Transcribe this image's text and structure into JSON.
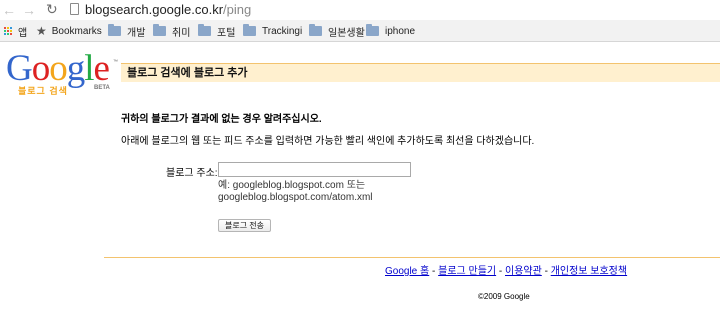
{
  "browser": {
    "url_host": "blogsearch.google.co.kr",
    "url_path": "/ping"
  },
  "bookmarks_bar": {
    "apps_label": "앱",
    "bookmarks_label": "Bookmarks",
    "folders": [
      "개발",
      "취미",
      "포털",
      "Trackingi",
      "일본생활",
      "iphone"
    ]
  },
  "logo": {
    "wordmark": "Google",
    "trademark": "™",
    "subtitle": "블로그 검색",
    "badge": "BETA",
    "colors": {
      "blue": "#3366cc",
      "red": "#dd2222",
      "yellow": "#f3a51c",
      "green": "#22aa44"
    }
  },
  "header": {
    "title": "블로그 검색에 블로그 추가",
    "accent_bg": "#fff0cf",
    "accent_border": "#f3c36e"
  },
  "form": {
    "intro": "귀하의 블로그가 결과에 없는 경우 알려주십시오.",
    "instructions": "아래에 블로그의 웹 또는 피드 주소를 입력하면 가능한 빨리 색인에 추가하도록 최선을 다하겠습니다.",
    "field_label": "블로그 주소:",
    "field_value": "",
    "example_line1": "예: googleblog.blogspot.com 또는",
    "example_line2": "googleblog.blogspot.com/atom.xml",
    "submit_label": "블로그 전송"
  },
  "footer": {
    "links": [
      "Google 홈",
      "블로그 만들기",
      "이용약관",
      "개인정보 보호정책"
    ],
    "separator": " - ",
    "copyright": "©2009 Google"
  }
}
